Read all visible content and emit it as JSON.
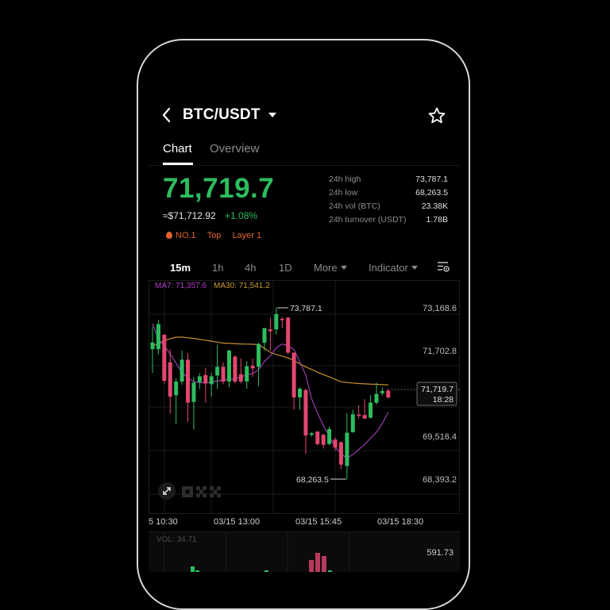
{
  "header": {
    "pair": "BTC/USDT"
  },
  "tabs": [
    {
      "label": "Chart",
      "active": true
    },
    {
      "label": "Overview",
      "active": false
    }
  ],
  "ticker": {
    "last_price": "71,719.7",
    "usd_price": "≈$71,712.92",
    "change_pct": "+1.08%",
    "tags": [
      "NO.1",
      "Top",
      "Layer 1"
    ],
    "stats": [
      {
        "label": "24h high",
        "value": "73,787.1"
      },
      {
        "label": "24h low",
        "value": "68,263.5"
      },
      {
        "label": "24h vol (BTC)",
        "value": "23.38K"
      },
      {
        "label": "24h turnover (USDT)",
        "value": "1.78B"
      }
    ]
  },
  "timeframes": {
    "items": [
      "15m",
      "1h",
      "4h",
      "1D"
    ],
    "active": "15m",
    "more_label": "More",
    "indicator_label": "Indicator"
  },
  "colors": {
    "up": "#2ebd5f",
    "down": "#e2476f",
    "ma7": "#9a3db0",
    "ma30": "#c8902a"
  },
  "chart_data": {
    "type": "candlestick",
    "title": "BTC/USDT 15m",
    "ma_legend": {
      "ma7": "MA7: 71,357.6",
      "ma30": "MA30: 71,541.2"
    },
    "y_tick_labels": [
      "73,168.6",
      "71,702.8",
      "69,516.4",
      "68,393.2"
    ],
    "x_tick_labels": [
      "5 10:30",
      "03/15 13:00",
      "03/15 15:45",
      "03/15 18:30"
    ],
    "high_marker": "73,787.1",
    "low_marker": "68,263.5",
    "current_price_label": "71,719.7",
    "current_time_label": "18:28",
    "ylim": [
      68263.5,
      73787.1
    ],
    "candles": [
      [
        72452.9,
        73175.2,
        71688.1,
        72665.4
      ],
      [
        72452.9,
        73387.7,
        72283.0,
        73260.2
      ],
      [
        72920.3,
        72920.3,
        71348.2,
        71433.2
      ],
      [
        72028.0,
        72452.9,
        70370.9,
        70923.3
      ],
      [
        70965.8,
        71518.1,
        70031.0,
        71407.7
      ],
      [
        71407.7,
        72410.4,
        71305.7,
        72113.0
      ],
      [
        72113.0,
        72325.4,
        70116.0,
        70727.8
      ],
      [
        70753.3,
        71560.6,
        69861.0,
        71373.7
      ],
      [
        71390.7,
        71688.1,
        71178.2,
        71577.6
      ],
      [
        71620.1,
        71858.1,
        70727.8,
        71348.2
      ],
      [
        71322.7,
        71688.1,
        70923.3,
        71577.6
      ],
      [
        71603.1,
        72597.4,
        71178.2,
        71883.6
      ],
      [
        71883.6,
        72028.0,
        71322.7,
        71407.7
      ],
      [
        71407.7,
        72427.4,
        71220.7,
        72410.4
      ],
      [
        72215.0,
        72257.5,
        71348.2,
        71407.7
      ],
      [
        71645.6,
        72155.5,
        71348.2,
        71407.7
      ],
      [
        71407.7,
        72070.5,
        71178.2,
        71900.6
      ],
      [
        71917.6,
        72155.5,
        71560.6,
        71832.6
      ],
      [
        71883.6,
        72665.4,
        71263.2,
        72622.9
      ],
      [
        72665.4,
        73132.8,
        72410.4,
        73132.8
      ],
      [
        73090.3,
        73472.7,
        72410.4,
        73030.8
      ],
      [
        73090.3,
        73787.1,
        72920.3,
        73583.1
      ],
      [
        73430.2,
        73498.2,
        73132.8,
        73387.7
      ],
      [
        73472.7,
        73472.7,
        72283.0,
        72342.5
      ],
      [
        72342.5,
        72342.5,
        70498.4,
        70897.8
      ],
      [
        70897.8,
        71220.7,
        70498.4,
        71178.2
      ],
      [
        71135.7,
        71178.2,
        69079.2,
        69674.0
      ],
      [
        69691.0,
        69776.0,
        69623.1,
        69742.0
      ],
      [
        69793.0,
        69818.5,
        69351.1,
        69393.6
      ],
      [
        69691.0,
        69733.5,
        69249.2,
        69368.1
      ],
      [
        69393.6,
        69963.0,
        69351.1,
        69878.0
      ],
      [
        69538.1,
        69606.1,
        69181.2,
        69283.2
      ],
      [
        69453.1,
        69478.6,
        68586.3,
        68730.8
      ],
      [
        68688.3,
        70387.9,
        68263.5,
        69759.0
      ],
      [
        69776.0,
        70498.4,
        69759.0,
        70353.9
      ],
      [
        70345.4,
        70643.0,
        70218.0,
        70302.9
      ],
      [
        70328.4,
        70838.3,
        70201.0,
        70218.0
      ],
      [
        70243.5,
        70965.8,
        70218.0,
        70727.8
      ],
      [
        70727.8,
        71373.7,
        70668.3,
        71008.3
      ],
      [
        71033.8,
        71220.7,
        70965.8,
        71101.7
      ],
      [
        71118.7,
        71178.2,
        70863.8,
        70897.8
      ]
    ],
    "ma7": [
      73277,
      72768,
      72555,
      72301,
      72003,
      71700,
      71530,
      71407,
      71373,
      71365,
      71390,
      71425,
      71460,
      71475,
      71500,
      71560,
      71620,
      71670,
      71790,
      72060,
      72240,
      72500,
      72620,
      72560,
      72440,
      72040,
      71620,
      70850,
      70400,
      69990,
      69650,
      69300,
      69080,
      68930,
      69060,
      69220,
      69380,
      69580,
      69780,
      70060,
      70420
    ],
    "ma30": [
      72550,
      72640,
      72720,
      72790,
      72840,
      72840,
      72820,
      72800,
      72770,
      72740,
      72710,
      72680,
      72650,
      72640,
      72630,
      72620,
      72615,
      72610,
      72600,
      72480,
      72350,
      72280,
      72230,
      72170,
      72090,
      71980,
      71880,
      71800,
      71710,
      71630,
      71560,
      71480,
      71400,
      71380,
      71360,
      71345,
      71335,
      71325,
      71320,
      71310,
      71300
    ],
    "volume": {
      "label": "VOL: 34.71",
      "max_label": "591.73"
    }
  }
}
